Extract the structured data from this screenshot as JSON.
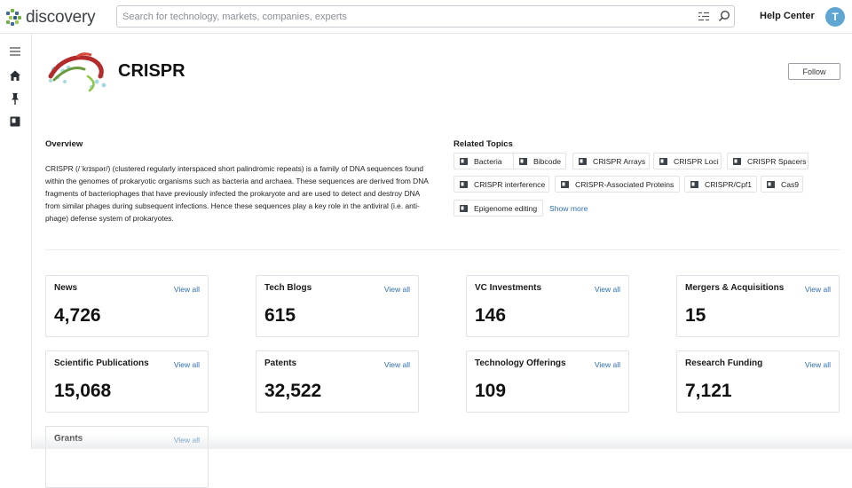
{
  "app": {
    "logo_text": "discovery"
  },
  "search": {
    "placeholder": "Search for technology, markets, companies, experts"
  },
  "header": {
    "help_label": "Help Center",
    "avatar_initial": "T"
  },
  "topic": {
    "title": "CRISPR",
    "follow_label": "Follow"
  },
  "overview": {
    "heading": "Overview",
    "text": "CRISPR (/ˈkrɪspər/) (clustered regularly interspaced short palindromic repeats) is a family of DNA sequences found within the genomes of prokaryotic organisms such as bacteria and archaea. These sequences are derived from DNA fragments of bacteriophages that have previously infected the prokaryote and are used to detect and destroy DNA from similar phages during subsequent infections. Hence these sequences play a key role in the antiviral (i.e. anti-phage) defense system of prokaryotes."
  },
  "related": {
    "heading": "Related Topics",
    "topics": [
      "Bacteria",
      "Bibcode",
      "CRISPR Arrays",
      "CRISPR Loci",
      "CRISPR Spacers",
      "CRISPR interference",
      "CRISPR-Associated Proteins",
      "CRISPR/Cpf1",
      "Cas9",
      "Epigenome editing"
    ],
    "show_more": "Show more"
  },
  "stats": [
    {
      "title": "News",
      "value": "4,726",
      "link": "View all"
    },
    {
      "title": "Tech Blogs",
      "value": "615",
      "link": "View all"
    },
    {
      "title": "VC Investments",
      "value": "146",
      "link": "View all"
    },
    {
      "title": "Mergers & Acquisitions",
      "value": "15",
      "link": "View all"
    },
    {
      "title": "Scientific Publications",
      "value": "15,068",
      "link": "View all"
    },
    {
      "title": "Patents",
      "value": "32,522",
      "link": "View all"
    },
    {
      "title": "Technology Offerings",
      "value": "109",
      "link": "View all"
    },
    {
      "title": "Research Funding",
      "value": "7,121",
      "link": "View all"
    },
    {
      "title": "Grants",
      "value": "",
      "link": "View all"
    }
  ],
  "colors": {
    "accent": "#2f6fb3",
    "avatar": "#5fa6d2"
  },
  "rail": {
    "icons": [
      "menu-icon",
      "home-icon",
      "pin-icon",
      "book-icon"
    ]
  }
}
